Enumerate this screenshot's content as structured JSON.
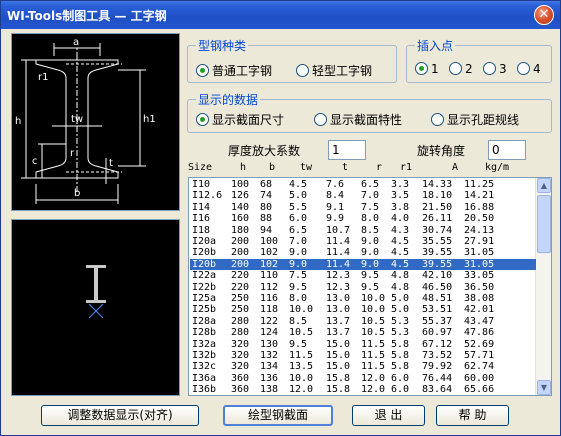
{
  "window": {
    "title": "WI-Tools制图工具 — 工字钢",
    "close_glyph": "✕"
  },
  "diagram_labels": {
    "a": "a",
    "r1": "r1",
    "h": "h",
    "tw": "tw",
    "h1": "h1",
    "c": "c",
    "r": "r",
    "t": "t",
    "b": "b"
  },
  "steel_type": {
    "legend": "型钢种类",
    "options": [
      "普通工字钢",
      "轻型工字钢"
    ],
    "selected": 0
  },
  "insert_point": {
    "legend": "插入点",
    "options": [
      "1",
      "2",
      "3",
      "4"
    ],
    "selected": 0
  },
  "display_data": {
    "legend": "显示的数据",
    "options": [
      "显示截面尺寸",
      "显示截面特性",
      "显示孔距规线"
    ],
    "selected": 0
  },
  "thickness_factor": {
    "label": "厚度放大系数",
    "value": "1"
  },
  "rotation_angle": {
    "label": "旋转角度",
    "value": "0"
  },
  "table": {
    "columns": [
      "Size",
      "h",
      "b",
      "tw",
      "t",
      "r",
      "r1",
      "A",
      "kg/m"
    ],
    "selected_index": 7,
    "rows": [
      [
        "I10",
        "100",
        "68",
        "4.5",
        "7.6",
        "6.5",
        "3.3",
        "14.33",
        "11.25"
      ],
      [
        "I12.6",
        "126",
        "74",
        "5.0",
        "8.4",
        "7.0",
        "3.5",
        "18.10",
        "14.21"
      ],
      [
        "I14",
        "140",
        "80",
        "5.5",
        "9.1",
        "7.5",
        "3.8",
        "21.50",
        "16.88"
      ],
      [
        "I16",
        "160",
        "88",
        "6.0",
        "9.9",
        "8.0",
        "4.0",
        "26.11",
        "20.50"
      ],
      [
        "I18",
        "180",
        "94",
        "6.5",
        "10.7",
        "8.5",
        "4.3",
        "30.74",
        "24.13"
      ],
      [
        "I20a",
        "200",
        "100",
        "7.0",
        "11.4",
        "9.0",
        "4.5",
        "35.55",
        "27.91"
      ],
      [
        "I20b",
        "200",
        "102",
        "9.0",
        "11.4",
        "9.0",
        "4.5",
        "39.55",
        "31.05"
      ],
      [
        "I20b",
        "200",
        "102",
        "9.0",
        "11.4",
        "9.0",
        "4.5",
        "39.55",
        "31.05"
      ],
      [
        "I22a",
        "220",
        "110",
        "7.5",
        "12.3",
        "9.5",
        "4.8",
        "42.10",
        "33.05"
      ],
      [
        "I22b",
        "220",
        "112",
        "9.5",
        "12.3",
        "9.5",
        "4.8",
        "46.50",
        "36.50"
      ],
      [
        "I25a",
        "250",
        "116",
        "8.0",
        "13.0",
        "10.0",
        "5.0",
        "48.51",
        "38.08"
      ],
      [
        "I25b",
        "250",
        "118",
        "10.0",
        "13.0",
        "10.0",
        "5.0",
        "53.51",
        "42.01"
      ],
      [
        "I28a",
        "280",
        "122",
        "8.5",
        "13.7",
        "10.5",
        "5.3",
        "55.37",
        "43.47"
      ],
      [
        "I28b",
        "280",
        "124",
        "10.5",
        "13.7",
        "10.5",
        "5.3",
        "60.97",
        "47.86"
      ],
      [
        "I32a",
        "320",
        "130",
        "9.5",
        "15.0",
        "11.5",
        "5.8",
        "67.12",
        "52.69"
      ],
      [
        "I32b",
        "320",
        "132",
        "11.5",
        "15.0",
        "11.5",
        "5.8",
        "73.52",
        "57.71"
      ],
      [
        "I32c",
        "320",
        "134",
        "13.5",
        "15.0",
        "11.5",
        "5.8",
        "79.92",
        "62.74"
      ],
      [
        "I36a",
        "360",
        "136",
        "10.0",
        "15.8",
        "12.0",
        "6.0",
        "76.44",
        "60.00"
      ],
      [
        "I36b",
        "360",
        "138",
        "12.0",
        "15.8",
        "12.0",
        "6.0",
        "83.64",
        "65.66"
      ]
    ]
  },
  "buttons": {
    "adjust": "调整数据显示(对齐)",
    "draw": "绘型钢截面",
    "exit": "退 出",
    "help": "帮 助"
  }
}
